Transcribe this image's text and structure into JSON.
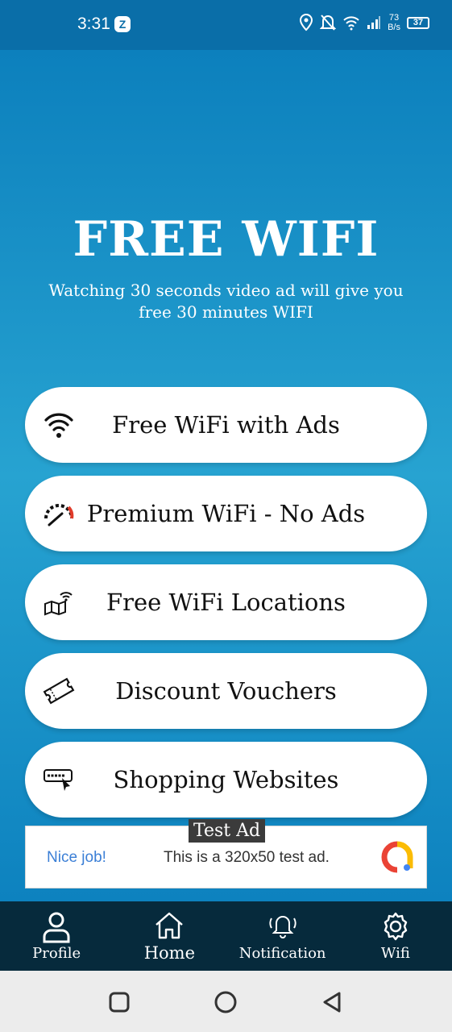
{
  "status_bar": {
    "time": "3:31",
    "app_badge": "Z",
    "net_speed_value": "73",
    "net_speed_unit": "B/s",
    "battery": "37"
  },
  "hero": {
    "title": "FREE WIFI",
    "subtitle": "Watching 30 seconds video ad will give you free 30 minutes WIFI"
  },
  "menu": [
    {
      "label": "Free WiFi with Ads",
      "icon": "wifi-icon"
    },
    {
      "label": "Premium WiFi - No Ads",
      "icon": "speedometer-icon"
    },
    {
      "label": "Free WiFi Locations",
      "icon": "map-wifi-icon"
    },
    {
      "label": "Discount Vouchers",
      "icon": "voucher-icon"
    },
    {
      "label": "Shopping Websites",
      "icon": "web-cursor-icon"
    }
  ],
  "ad": {
    "tag": "Test Ad",
    "nice": "Nice job!",
    "text": "This is a 320x50 test ad."
  },
  "bottom_nav": [
    {
      "label": "Profile",
      "icon": "person-icon"
    },
    {
      "label": "Home",
      "icon": "home-icon"
    },
    {
      "label": "Notification",
      "icon": "bell-icon"
    },
    {
      "label": "Wifi",
      "icon": "gear-icon"
    }
  ],
  "colors": {
    "primary": "#0c80bd",
    "nav_background": "#062a3c",
    "button_background": "#ffffff"
  }
}
